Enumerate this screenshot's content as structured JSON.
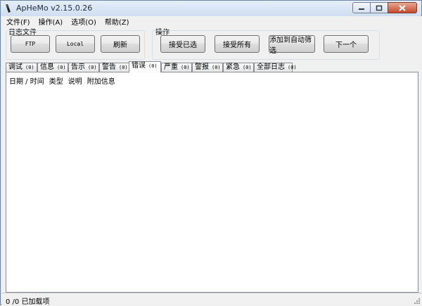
{
  "window": {
    "title": "ApHeMo v2.15.0.26"
  },
  "menu": [
    "文件(F)",
    "操作(A)",
    "选项(O)",
    "帮助(Z)"
  ],
  "log_group": {
    "label": "日志文件",
    "buttons": [
      "FTP",
      "Local",
      "刷新"
    ]
  },
  "action_group": {
    "label": "操作",
    "buttons": [
      "接受已选",
      "接受所有",
      "添加到自动筛选",
      "下一个"
    ]
  },
  "tabs": [
    {
      "label": "调试",
      "count": "(0)"
    },
    {
      "label": "信息",
      "count": "(0)"
    },
    {
      "label": "告示",
      "count": "(0)"
    },
    {
      "label": "警告",
      "count": "(0)"
    },
    {
      "label": "错误",
      "count": "(0)"
    },
    {
      "label": "严重",
      "count": "(0)"
    },
    {
      "label": "警报",
      "count": "(0)"
    },
    {
      "label": "紧急",
      "count": "(0)"
    },
    {
      "label": "全部日志",
      "count": "(0)"
    }
  ],
  "active_tab": "错误",
  "columns": [
    "日期 / 时间",
    "类型",
    "说明",
    "附加信息"
  ],
  "status": "0 /0 已加载项",
  "colors": {
    "frame": "#6e87a8",
    "close_button": "#c44a2c"
  }
}
